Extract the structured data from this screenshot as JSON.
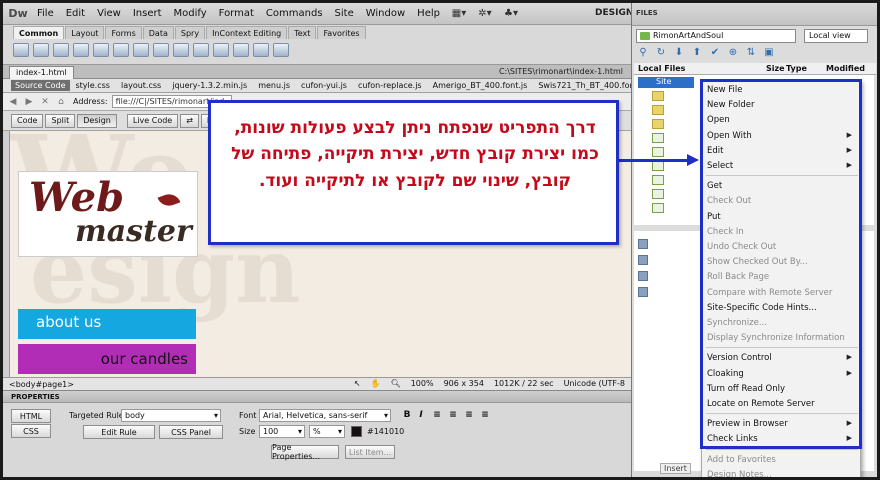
{
  "menubar": {
    "app": "Dw",
    "items": [
      "File",
      "Edit",
      "View",
      "Insert",
      "Modify",
      "Format",
      "Commands",
      "Site",
      "Window",
      "Help"
    ],
    "workspace": "DESIGNE"
  },
  "insert_bar": {
    "tabs": [
      "Common",
      "Layout",
      "Forms",
      "Data",
      "Spry",
      "InContext Editing",
      "Text",
      "Favorites"
    ]
  },
  "document": {
    "tab": "index-1.html",
    "path": "C:\\SITES\\rimonart\\index-1.html",
    "source_code": "Source Code",
    "related_files": [
      "style.css",
      "layout.css",
      "jquery-1.3.2.min.js",
      "menu.js",
      "cufon-yui.js",
      "cufon-replace.js",
      "Amerigo_BT_400.font.js",
      "Swis721_Th_BT_400.font.js"
    ],
    "address_label": "Address:",
    "address_value": "file:///C|/SITES/rimonart/ind",
    "view_buttons": [
      "Code",
      "Split",
      "Design",
      "Live Code",
      "Liv"
    ]
  },
  "canvas": {
    "logo_word1": "Web",
    "logo_word2": "master",
    "nav_about": "about us",
    "nav_candles": "our candles"
  },
  "status": {
    "tag": "<body#page1>",
    "zoom": "100%",
    "size": "906 x 354",
    "weight": "1012K / 22 sec",
    "encoding": "Unicode (UTF-8"
  },
  "properties": {
    "title": "PROPERTIES",
    "html": "HTML",
    "css": "CSS",
    "targeted_rule_label": "Targeted Rule",
    "targeted_rule": "body",
    "edit_rule": "Edit Rule",
    "css_panel": "CSS Panel",
    "font_label": "Font",
    "font_value": "Arial, Helvetica, sans-serif",
    "size_label": "Size",
    "size_value": "100",
    "size_unit": "%",
    "color_value": "#141010",
    "page_properties": "Page Properties...",
    "list_item": "List Item..."
  },
  "files_panel": {
    "title": "FILES",
    "site": "RimonArtAndSoul",
    "view": "Local view",
    "cols": [
      "Local Files",
      "Size",
      "Type",
      "Modified"
    ],
    "root": "Site"
  },
  "context_menu": {
    "items": [
      {
        "label": "New File",
        "disabled": false
      },
      {
        "label": "New Folder",
        "disabled": false
      },
      {
        "label": "Open",
        "disabled": false
      },
      {
        "label": "Open With",
        "disabled": false,
        "submenu": true
      },
      {
        "label": "Edit",
        "disabled": false,
        "submenu": true
      },
      {
        "label": "Select",
        "disabled": false,
        "submenu": true
      },
      {
        "label": "Get",
        "disabled": false
      },
      {
        "label": "Check Out",
        "disabled": true
      },
      {
        "label": "Put",
        "disabled": false
      },
      {
        "label": "Check In",
        "disabled": true
      },
      {
        "label": "Undo Check Out",
        "disabled": true
      },
      {
        "label": "Show Checked Out By...",
        "disabled": true
      },
      {
        "label": "Roll Back Page",
        "disabled": true
      },
      {
        "label": "Compare with Remote Server",
        "disabled": true
      },
      {
        "label": "Site-Specific Code Hints...",
        "disabled": false
      },
      {
        "label": "Synchronize...",
        "disabled": true
      },
      {
        "label": "Display Synchronize Information",
        "disabled": true
      },
      {
        "label": "Version Control",
        "disabled": false,
        "submenu": true
      },
      {
        "label": "Cloaking",
        "disabled": false,
        "submenu": true
      },
      {
        "label": "Turn off Read Only",
        "disabled": false
      },
      {
        "label": "Locate on Remote Server",
        "disabled": false
      },
      {
        "label": "Preview in Browser",
        "disabled": false,
        "submenu": true
      },
      {
        "label": "Check Links",
        "disabled": false,
        "submenu": true
      },
      {
        "label": "Add to Favorites",
        "disabled": true
      },
      {
        "label": "Design Notes...",
        "disabled": true
      }
    ],
    "insert_stub": "Insert"
  },
  "callout": {
    "text": "דרך התפריט שנפתח ניתן לבצע פעולות שונות, כמו יצירת קובץ חדש, יצירת תיקייה, פתיחה של קובץ, שינוי שם לקובץ או לתיקייה ועוד."
  },
  "colors": {
    "accent": "#1f2fc5",
    "callout_text": "#c5081a",
    "nav_about": "#14a7e0",
    "nav_candles": "#b12db5"
  }
}
